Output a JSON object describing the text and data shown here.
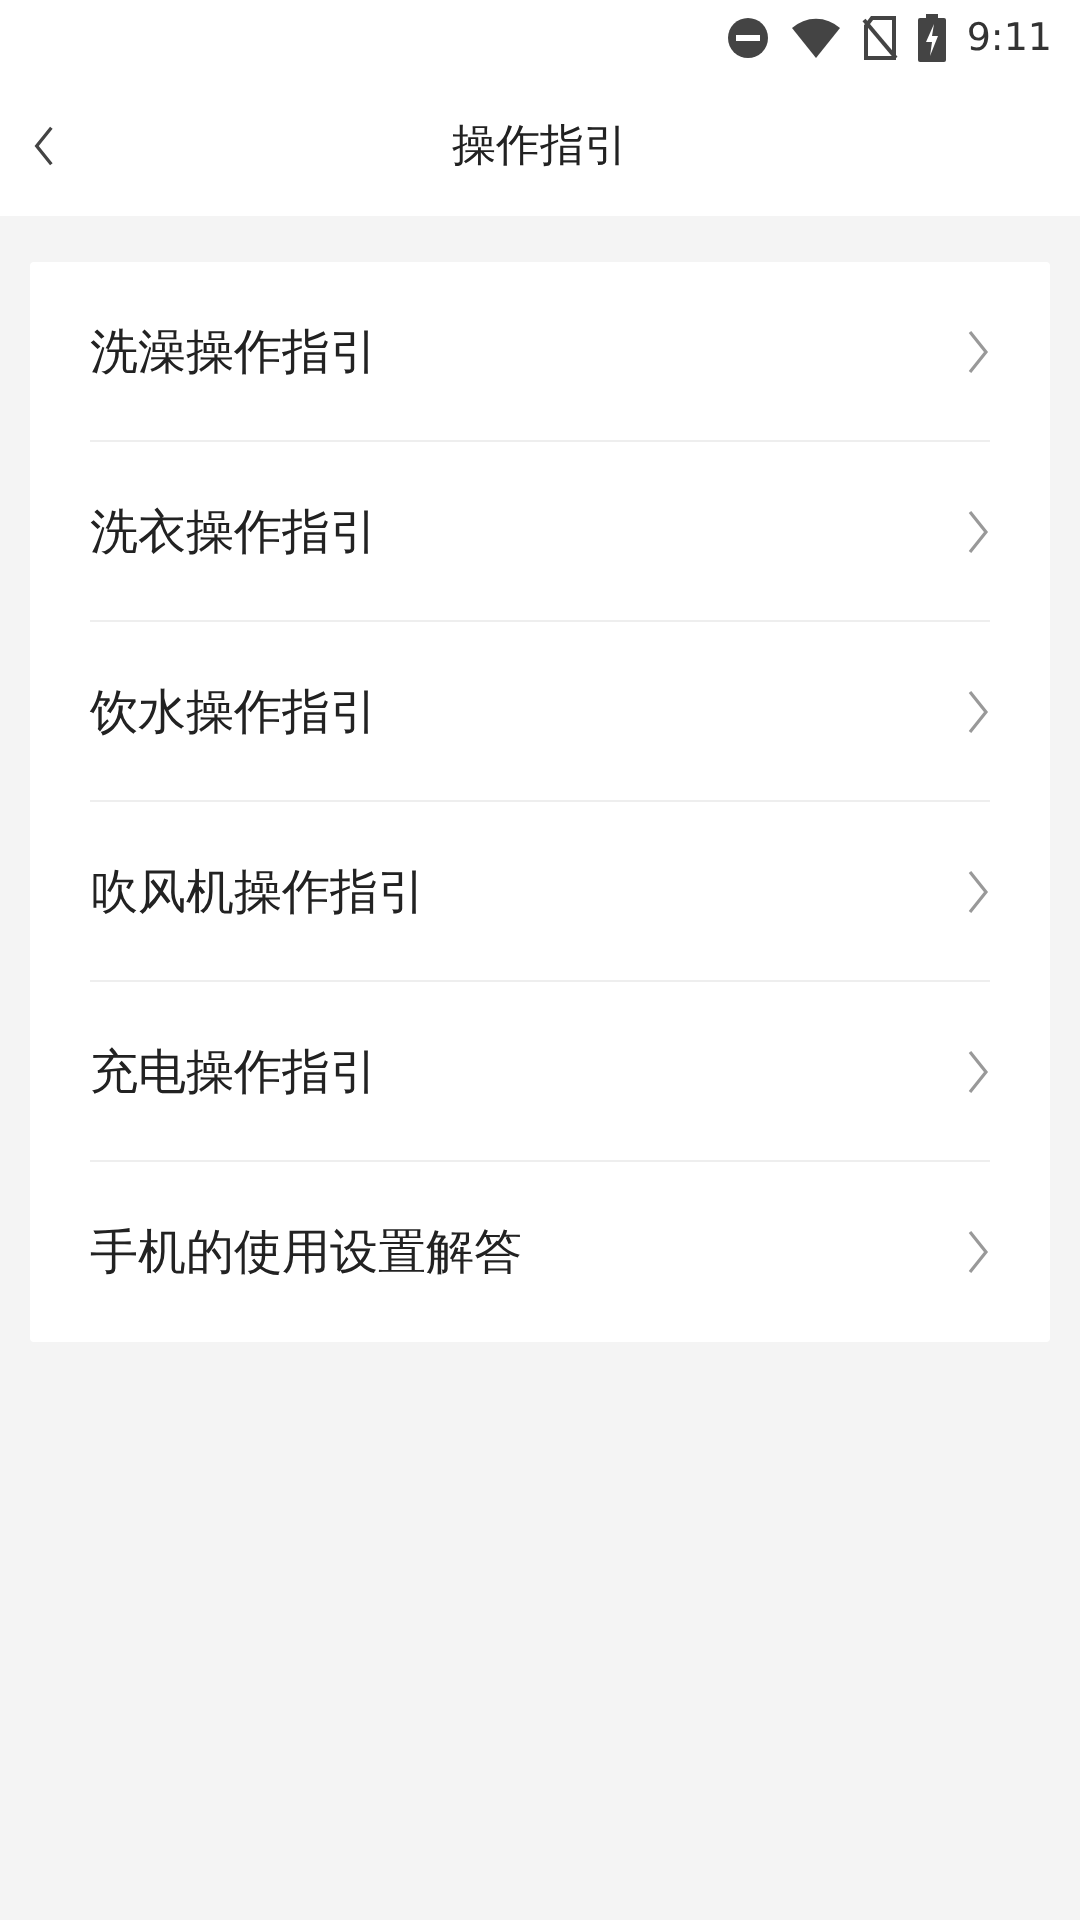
{
  "status_bar": {
    "time": "9:11"
  },
  "header": {
    "title": "操作指引"
  },
  "items": [
    {
      "label": "洗澡操作指引"
    },
    {
      "label": "洗衣操作指引"
    },
    {
      "label": "饮水操作指引"
    },
    {
      "label": "吹风机操作指引"
    },
    {
      "label": "充电操作指引"
    },
    {
      "label": "手机的使用设置解答"
    }
  ]
}
